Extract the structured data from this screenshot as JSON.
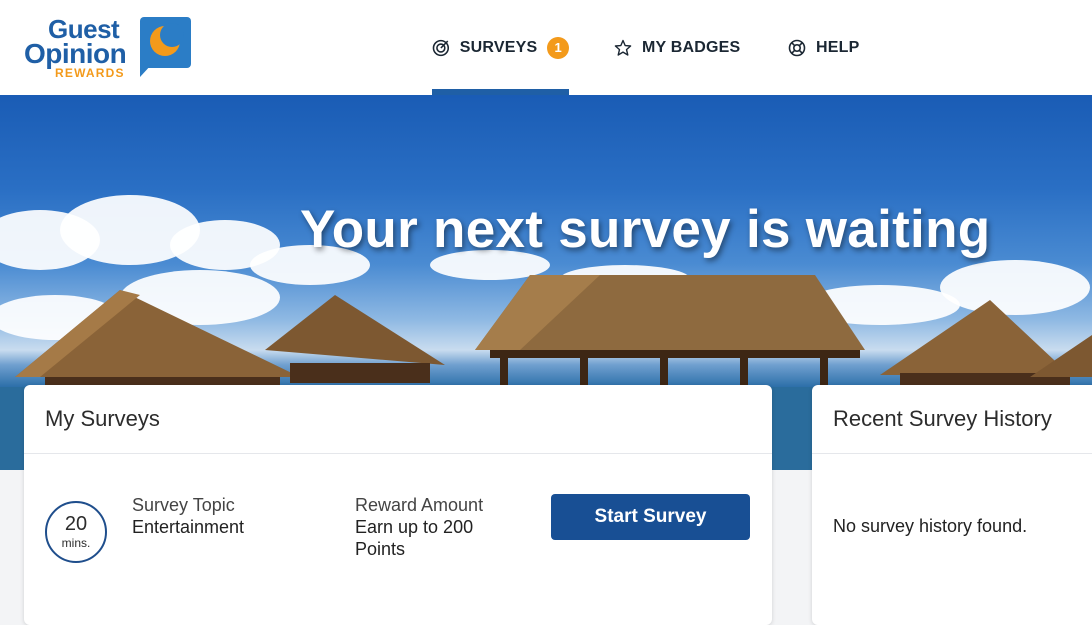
{
  "logo": {
    "line1": "Guest",
    "line2": "Opinion",
    "line3": "REWARDS"
  },
  "nav": {
    "surveys": {
      "label": "SURVEYS",
      "badge": "1",
      "icon": "target-icon"
    },
    "badges": {
      "label": "MY BADGES",
      "icon": "star-icon"
    },
    "help": {
      "label": "HELP",
      "icon": "lifebuoy-icon"
    }
  },
  "hero": {
    "title": "Your next survey is waiting"
  },
  "my_surveys": {
    "title": "My Surveys",
    "timer_value": "20",
    "timer_unit": "mins.",
    "topic_label": "Survey Topic",
    "topic_value": "Entertainment",
    "reward_label": "Reward Amount",
    "reward_value": "Earn up to 200 Points",
    "start_label": "Start Survey"
  },
  "history": {
    "title": "Recent Survey History",
    "empty": "No survey history found."
  },
  "colors": {
    "brand_blue": "#1f5fa6",
    "accent_orange": "#f39a1b",
    "button_blue": "#184f94"
  }
}
